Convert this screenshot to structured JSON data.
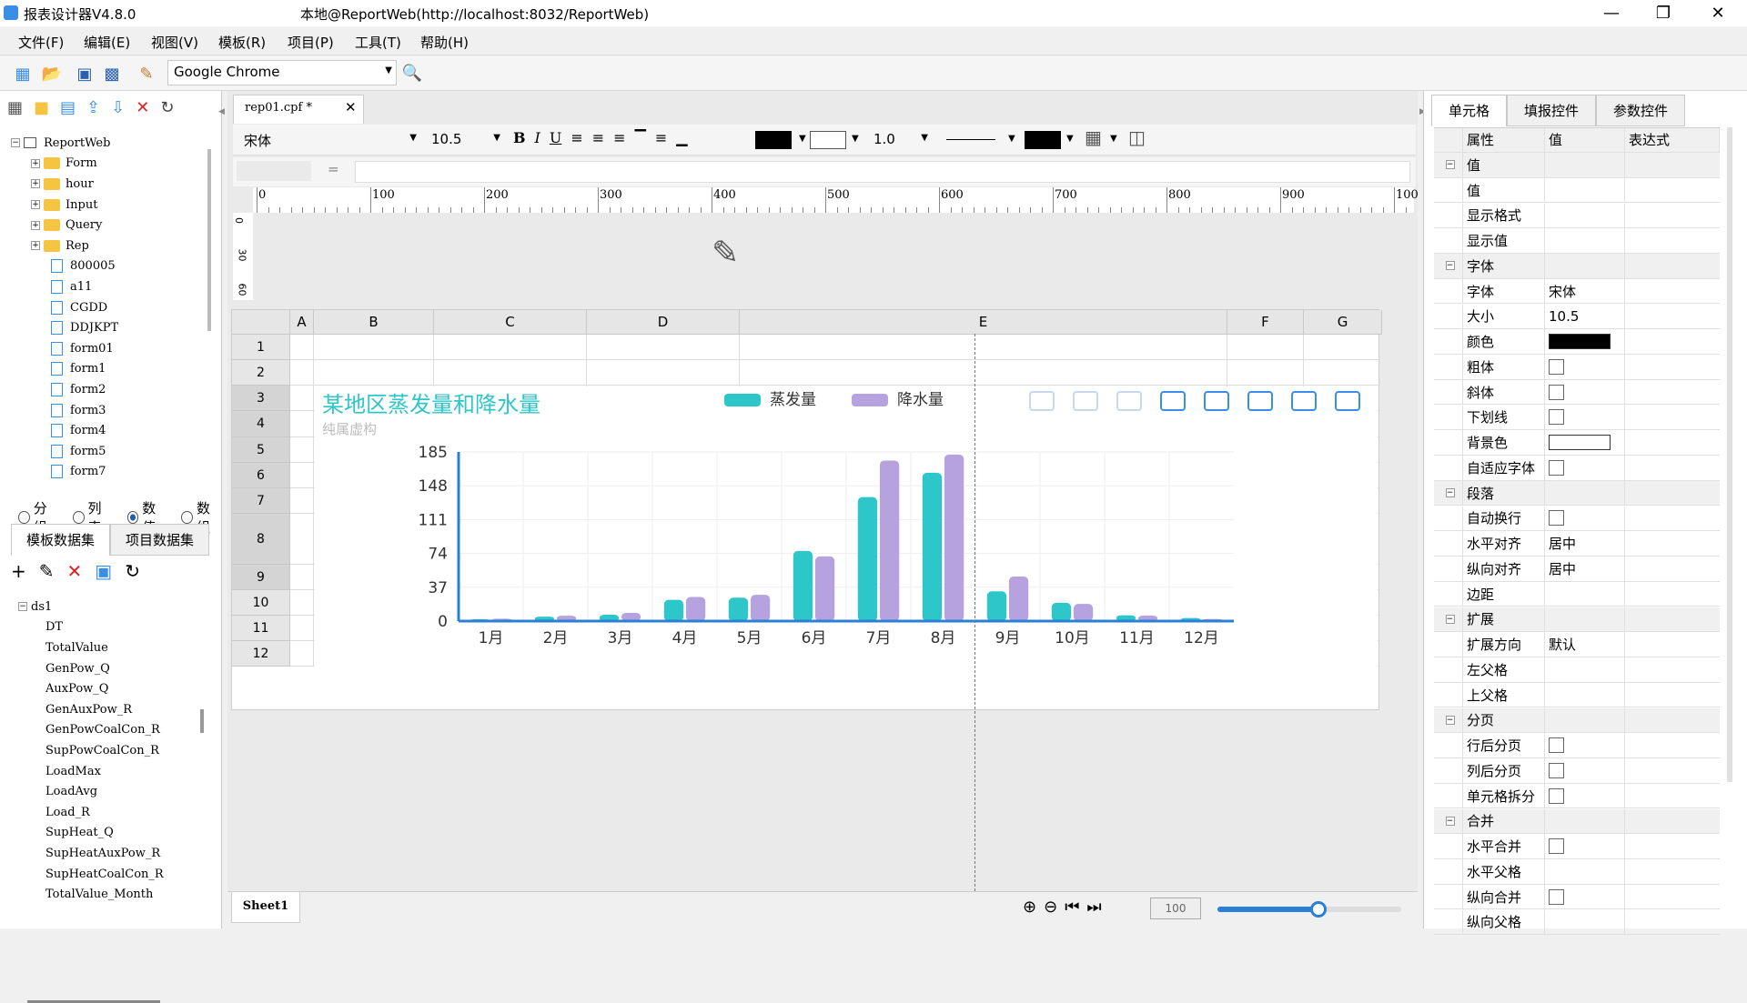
{
  "window": {
    "app_title": "报表设计器V4.8.0",
    "connection": "本地@ReportWeb(http://localhost:8032/ReportWeb)"
  },
  "menu": [
    "文件(F)",
    "编辑(E)",
    "视图(V)",
    "模板(R)",
    "项目(P)",
    "工具(T)",
    "帮助(H)"
  ],
  "toolbar": {
    "browser": "Google Chrome"
  },
  "left": {
    "tree_root": "ReportWeb",
    "folders": [
      "Form",
      "hour",
      "Input",
      "Query",
      "Rep"
    ],
    "files": [
      "800005",
      "a11",
      "CGDD",
      "DDJKPT",
      "form01",
      "form1",
      "form2",
      "form3",
      "form4",
      "form5",
      "form7"
    ],
    "radios": [
      {
        "label": "分组",
        "checked": false
      },
      {
        "label": "列表",
        "checked": false
      },
      {
        "label": "数值",
        "checked": true
      },
      {
        "label": "数组",
        "checked": false
      }
    ],
    "tabs": [
      "模板数据集",
      "项目数据集"
    ],
    "dataset": "ds1",
    "fields": [
      "DT",
      "TotalValue",
      "GenPow_Q",
      "AuxPow_Q",
      "GenAuxPow_R",
      "GenPowCoalCon_R",
      "SupPowCoalCon_R",
      "LoadMax",
      "LoadAvg",
      "Load_R",
      "SupHeat_Q",
      "SupHeatAuxPow_R",
      "SupHeatCoalCon_R",
      "TotalValue_Month"
    ]
  },
  "editor": {
    "file_tab": "rep01.cpf *",
    "font": "宋体",
    "size": "10.5",
    "line_width": "1.0",
    "formula_eq": "=",
    "ruler_labels": [
      "0",
      "100",
      "200",
      "300",
      "400",
      "500",
      "600",
      "700",
      "800",
      "900",
      "100"
    ],
    "vruler_labels": [
      "0",
      "30",
      "60"
    ],
    "columns": [
      "A",
      "B",
      "C",
      "D",
      "E",
      "F",
      "G"
    ],
    "rows": [
      "1",
      "2",
      "3",
      "4",
      "5",
      "6",
      "7",
      "8",
      "9",
      "10",
      "11",
      "12"
    ],
    "sheet_tab": "Sheet1",
    "zoom": "100",
    "zoom_slider_fraction": 0.55
  },
  "colors": {
    "series1": "#2ec7c9",
    "series2": "#b6a2de",
    "title": "#2ec7c9",
    "accent": "#3a8ee6"
  },
  "chart_data": {
    "type": "bar",
    "title": "某地区蒸发量和降水量",
    "subtitle": "纯属虚构",
    "categories": [
      "1月",
      "2月",
      "3月",
      "4月",
      "5月",
      "6月",
      "7月",
      "8月",
      "9月",
      "10月",
      "11月",
      "12月"
    ],
    "series": [
      {
        "name": "蒸发量",
        "values": [
          2.0,
          4.9,
          7.0,
          23.2,
          25.6,
          76.7,
          135.6,
          162.2,
          32.6,
          20.0,
          6.4,
          3.3
        ]
      },
      {
        "name": "降水量",
        "values": [
          2.6,
          5.9,
          9.0,
          26.4,
          28.7,
          70.7,
          175.6,
          182.2,
          48.7,
          18.8,
          6.0,
          2.3
        ]
      }
    ],
    "yticks": [
      "0",
      "37",
      "74",
      "111",
      "148",
      "185"
    ],
    "ylim": [
      0,
      185
    ],
    "grid": true,
    "legend": "top-center"
  },
  "right": {
    "tabs": [
      "单元格",
      "填报控件",
      "参数控件"
    ],
    "headers": [
      "属性",
      "值",
      "表达式"
    ],
    "rows": [
      {
        "label": "值",
        "group": true
      },
      {
        "label": "值"
      },
      {
        "label": "显示格式"
      },
      {
        "label": "显示值"
      },
      {
        "label": "字体",
        "group": true
      },
      {
        "label": "字体",
        "value": "宋体"
      },
      {
        "label": "大小",
        "value": "10.5"
      },
      {
        "label": "颜色",
        "swatch": "#000000"
      },
      {
        "label": "粗体",
        "check": true
      },
      {
        "label": "斜体",
        "check": true
      },
      {
        "label": "下划线",
        "check": true
      },
      {
        "label": "背景色",
        "swatch": "#ffffff"
      },
      {
        "label": "自适应字体",
        "check": true
      },
      {
        "label": "段落",
        "group": true
      },
      {
        "label": "自动换行",
        "check": true
      },
      {
        "label": "水平对齐",
        "value": "居中"
      },
      {
        "label": "纵向对齐",
        "value": "居中"
      },
      {
        "label": "边距"
      },
      {
        "label": "扩展",
        "group": true
      },
      {
        "label": "扩展方向",
        "value": "默认"
      },
      {
        "label": "左父格"
      },
      {
        "label": "上父格"
      },
      {
        "label": "分页",
        "group": true
      },
      {
        "label": "行后分页",
        "check": true
      },
      {
        "label": "列后分页",
        "check": true
      },
      {
        "label": "单元格拆分",
        "check": true
      },
      {
        "label": "合并",
        "group": true
      },
      {
        "label": "水平合并",
        "check": true
      },
      {
        "label": "水平父格"
      },
      {
        "label": "纵向合并",
        "check": true
      },
      {
        "label": "纵向父格"
      }
    ]
  }
}
